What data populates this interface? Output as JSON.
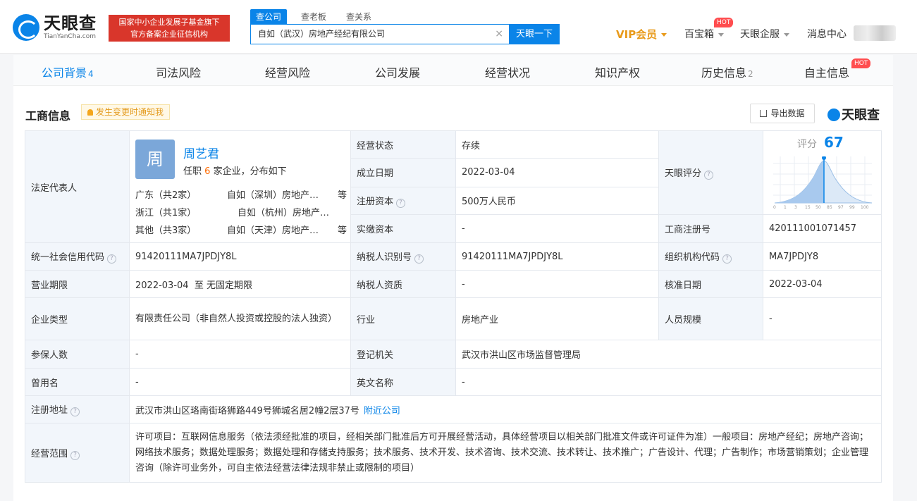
{
  "header": {
    "logo_cn": "天眼查",
    "logo_en": "TianYanCha.com",
    "gov_badge_line1": "国家中小企业发展子基金旗下",
    "gov_badge_line2": "官方备案企业征信机构",
    "search_tabs": [
      "查公司",
      "查老板",
      "查关系"
    ],
    "search_value": "自如（武汉）房地产经纪有限公司",
    "search_button": "天眼一下",
    "nav": {
      "vip": "VIP会员",
      "baibaoxiang": "百宝箱",
      "hot": "HOT",
      "enterprise": "天眼企服",
      "messages": "消息中心"
    }
  },
  "tabs": [
    {
      "label": "公司背景",
      "count": "4"
    },
    {
      "label": "司法风险"
    },
    {
      "label": "经营风险"
    },
    {
      "label": "公司发展"
    },
    {
      "label": "经营状况"
    },
    {
      "label": "知识产权"
    },
    {
      "label": "历史信息",
      "count": "2"
    },
    {
      "label": "自主信息",
      "hot": "HOT"
    }
  ],
  "section": {
    "title": "工商信息",
    "notify": "发生变更时通知我",
    "export": "导出数据",
    "brand": "天眼查"
  },
  "legal_rep": {
    "label": "法定代表人",
    "avatar_char": "周",
    "name": "周艺君",
    "sub_prefix": "任职",
    "sub_num": "6",
    "sub_suffix": "家企业，分布如下",
    "rows": [
      {
        "area": "广东（共2家）",
        "company": "自如（深圳）房地产…",
        "etc": "等"
      },
      {
        "area": "浙江（共1家）",
        "company": "自如（杭州）房地产…",
        "etc": ""
      },
      {
        "area": "其他（共3家）",
        "company": "自如（天津）房地产…",
        "etc": "等"
      }
    ]
  },
  "fields": {
    "biz_status_label": "经营状态",
    "biz_status": "存续",
    "est_date_label": "成立日期",
    "est_date": "2022-03-04",
    "reg_cap_label": "注册资本",
    "reg_cap": "500万人民币",
    "paid_cap_label": "实缴资本",
    "paid_cap": "-",
    "score_label": "天眼评分",
    "score_text": "评分",
    "score_value": "67",
    "score_ticks": [
      "0",
      "1",
      "3",
      "15",
      "50",
      "85",
      "97",
      "99",
      "100"
    ],
    "reg_no_label": "工商注册号",
    "reg_no": "420111001071457",
    "credit_code_label": "统一社会信用代码",
    "credit_code": "91420111MA7JPDJY8L",
    "taxpayer_id_label": "纳税人识别号",
    "taxpayer_id": "91420111MA7JPDJY8L",
    "org_code_label": "组织机构代码",
    "org_code": "MA7JPDJY8",
    "term_label": "营业期限",
    "term": "2022-03-04  至 无固定期限",
    "taxpayer_qual_label": "纳税人资质",
    "taxpayer_qual": "-",
    "approve_date_label": "核准日期",
    "approve_date": "2022-03-04",
    "type_label": "企业类型",
    "type": "有限责任公司（非自然人投资或控股的法人独资）",
    "industry_label": "行业",
    "industry": "房地产业",
    "staff_label": "人员规模",
    "staff": "-",
    "insured_label": "参保人数",
    "insured": "-",
    "authority_label": "登记机关",
    "authority": "武汉市洪山区市场监督管理局",
    "former_name_label": "曾用名",
    "former_name": "-",
    "en_name_label": "英文名称",
    "en_name": "-",
    "address_label": "注册地址",
    "address": "武汉市洪山区珞南街珞狮路449号狮城名居2幢2层37号",
    "address_link": "附近公司",
    "scope_label": "经营范围",
    "scope": "许可项目：互联网信息服务（依法须经批准的项目，经相关部门批准后方可开展经营活动，具体经营项目以相关部门批准文件或许可证件为准）一般项目：房地产经纪；房地产咨询；网络技术服务；数据处理服务；数据处理和存储支持服务；技术服务、技术开发、技术咨询、技术交流、技术转让、技术推广；广告设计、代理；广告制作；市场营销策划；企业管理咨询（除许可业务外，可自主依法经营法律法规非禁止或限制的项目）"
  }
}
